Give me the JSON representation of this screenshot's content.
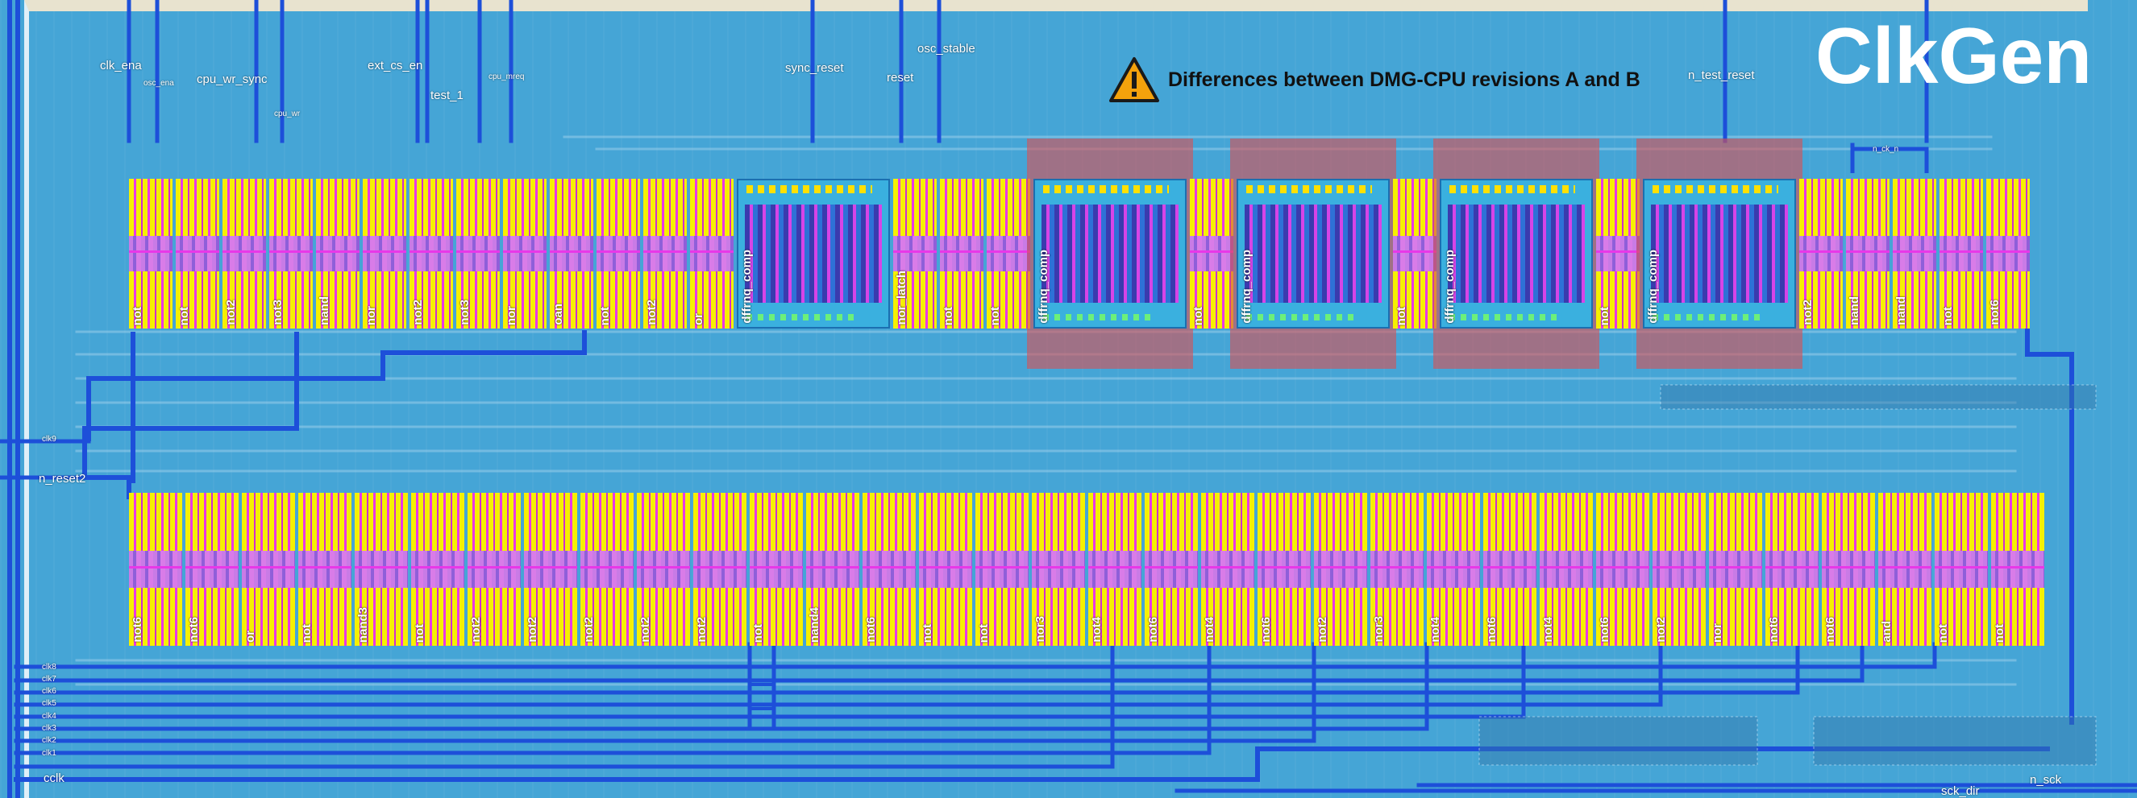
{
  "title": "ClkGen",
  "note": {
    "text": "Differences between DMG-CPU revisions A and B",
    "icon": "warning-icon"
  },
  "colors": {
    "substrate": "#45a5d6",
    "metal_wire": "#1d4fd9",
    "diffusion": "#f6f000",
    "poly": "#e838e8",
    "contact": "#3a2ea8",
    "highlight": "#d65056",
    "white_label": "#ffffff"
  },
  "signals_top": [
    "clk_ena",
    "osc_ena",
    "cpu_wr_sync",
    "cpu_wr",
    "ext_cs_en",
    "test_1",
    "cpu_mreq",
    "sync_reset",
    "reset",
    "osc_stable",
    "n_test_reset",
    "n_ck_n"
  ],
  "signals_left": [
    "clk9",
    "n_reset2",
    "clk8",
    "clk7",
    "clk6",
    "clk5",
    "clk4",
    "clk3",
    "clk2",
    "clk1",
    "cclk"
  ],
  "signals_bottom": [
    "sck_dir",
    "n_sck"
  ],
  "cells_top": [
    "not",
    "not",
    "not2",
    "not3",
    "nand",
    "nor",
    "not2",
    "not3",
    "nor",
    "oan",
    "not",
    "not2",
    "or",
    "dffrnq_comp",
    "nor_latch",
    "not",
    "not",
    "dffrnq_comp",
    "not",
    "dffrnq_comp",
    "not",
    "dffrnq_comp",
    "not",
    "dffrnq_comp",
    "not2",
    "nand",
    "nand",
    "not",
    "not6"
  ],
  "cells_bottom": [
    "not6",
    "not6",
    "or",
    "not",
    "nand3",
    "not",
    "not2",
    "not2",
    "not2",
    "not2",
    "not2",
    "not",
    "nand4",
    "not6",
    "not",
    "not",
    "nor3",
    "not4",
    "not6",
    "not4",
    "not6",
    "not2",
    "nor3",
    "not4",
    "not6",
    "not4",
    "not6",
    "not2",
    "nor",
    "not6",
    "not6",
    "and",
    "not",
    "not"
  ],
  "highlighted_cells": [
    "dffrnq_comp",
    "dffrnq_comp",
    "dffrnq_comp",
    "dffrnq_comp"
  ]
}
